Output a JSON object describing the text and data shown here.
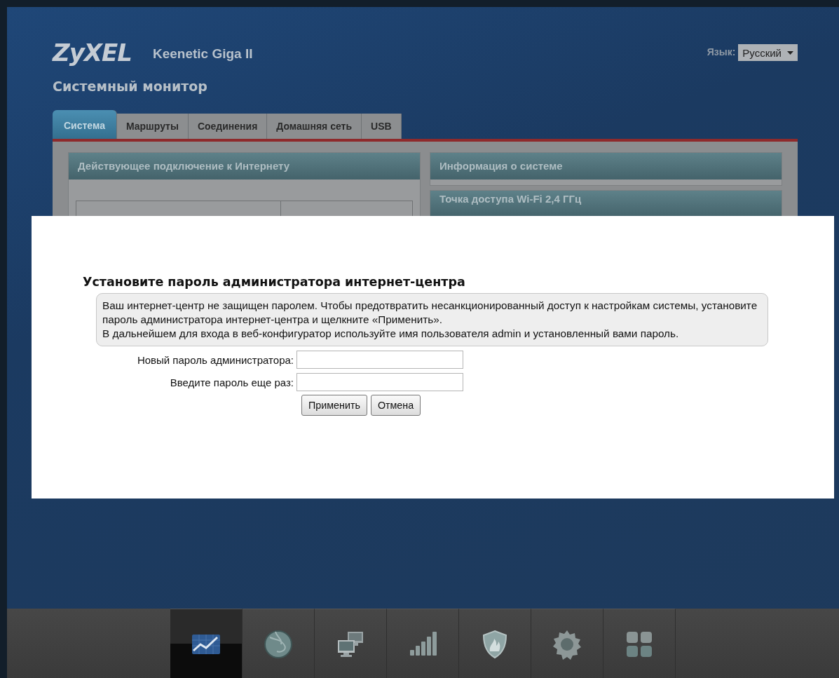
{
  "header": {
    "logo": "ZyXEL",
    "model": "Keenetic Giga II",
    "language_label": "Язык:",
    "language_value": "Русский"
  },
  "page_title": "Системный монитор",
  "tabs": [
    {
      "label": "Система",
      "selected": true
    },
    {
      "label": "Маршруты",
      "selected": false
    },
    {
      "label": "Соединения",
      "selected": false
    },
    {
      "label": "Домашняя сеть",
      "selected": false
    },
    {
      "label": "USB",
      "selected": false
    }
  ],
  "left_panels": [
    {
      "title": "Действующее подключение к Интернету"
    }
  ],
  "right_panels": [
    {
      "title": "Информация о системе"
    },
    {
      "title": "Точка доступа Wi-Fi 2,4 ГГц"
    }
  ],
  "dialog": {
    "title": "Установите пароль администратора интернет-центра",
    "notice": [
      "Ваш интернет-центр не защищен паролем. Чтобы предотвратить несанкционированный доступ к настройкам системы, установите пароль администратора интернет-центра и щелкните «Применить».",
      "В дальнейшем для входа в веб-конфигуратор используйте имя пользователя admin и установленный вами пароль."
    ],
    "fields": [
      {
        "label": "Новый пароль администратора:"
      },
      {
        "label": "Введите пароль еще раз:"
      }
    ],
    "buttons": [
      "Применить",
      "Отмена"
    ]
  },
  "bottom_nav": [
    {
      "kind": "monitor",
      "selected": true
    },
    {
      "kind": "internet",
      "selected": false
    },
    {
      "kind": "network",
      "selected": false
    },
    {
      "kind": "wifi",
      "selected": false
    },
    {
      "kind": "security",
      "selected": false
    },
    {
      "kind": "system",
      "selected": false
    },
    {
      "kind": "apps",
      "selected": false
    }
  ]
}
